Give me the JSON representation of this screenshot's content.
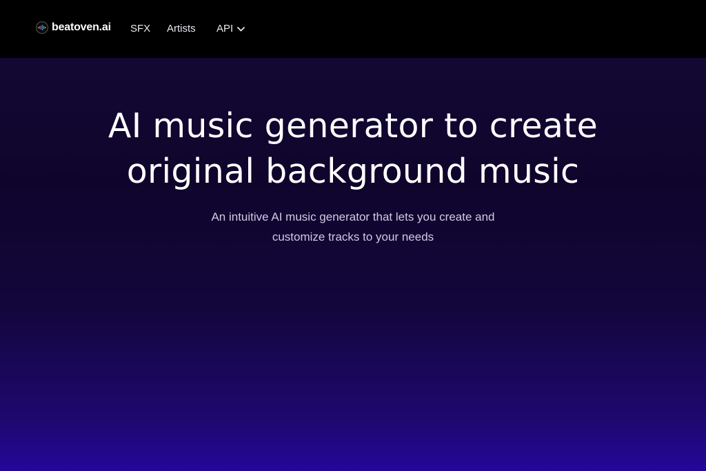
{
  "nav": {
    "brand": "beatoven.ai",
    "links": [
      {
        "label": "SFX"
      },
      {
        "label": "Artists"
      },
      {
        "label": "API"
      }
    ]
  },
  "hero": {
    "title_line1": "AI music generator to create",
    "title_line2": "original background music",
    "subtitle_line1": "An intuitive AI music generator that lets you create and",
    "subtitle_line2": "customize tracks to your needs"
  },
  "colors": {
    "nav_bg": "#000000",
    "hero_top": "#120833",
    "hero_bottom": "#24079a"
  },
  "icons": {
    "logo": "waveform-logo-icon",
    "api_dropdown": "chevron-down-icon"
  }
}
